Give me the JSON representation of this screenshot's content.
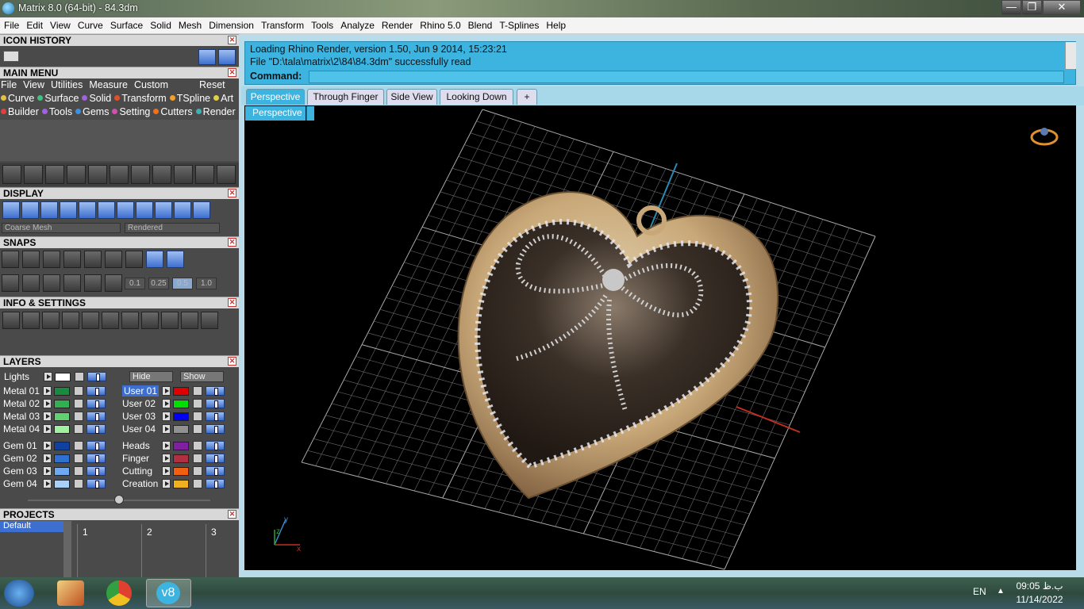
{
  "window": {
    "title": "Matrix 8.0 (64-bit) - 84.3dm",
    "min": "—",
    "max": "❐",
    "close": "✕"
  },
  "menubar": [
    "File",
    "Edit",
    "View",
    "Curve",
    "Surface",
    "Solid",
    "Mesh",
    "Dimension",
    "Transform",
    "Tools",
    "Analyze",
    "Render",
    "Rhino 5.0",
    "Blend",
    "T-Splines",
    "Help"
  ],
  "panels": {
    "icon_history": "ICON HISTORY",
    "main_menu": "MAIN MENU",
    "display": "DISPLAY",
    "snaps": "SNAPS",
    "info_settings": "INFO & SETTINGS",
    "layers": "LAYERS",
    "projects": "PROJECTS"
  },
  "main_menu": {
    "top": [
      "File",
      "View",
      "Utilities",
      "Measure",
      "Custom"
    ],
    "reset": "Reset",
    "row1": [
      {
        "label": "Curve",
        "color": "#e8c040"
      },
      {
        "label": "Surface",
        "color": "#40c080"
      },
      {
        "label": "Solid",
        "color": "#a060e0"
      },
      {
        "label": "Transform",
        "color": "#e05030"
      },
      {
        "label": "TSpline",
        "color": "#f0a030"
      },
      {
        "label": "Art",
        "color": "#e0d040"
      }
    ],
    "row2": [
      {
        "label": "Builder",
        "color": "#e04040"
      },
      {
        "label": "Tools",
        "color": "#a060e0"
      },
      {
        "label": "Gems",
        "color": "#4090e0"
      },
      {
        "label": "Setting",
        "color": "#d050b0"
      },
      {
        "label": "Cutters",
        "color": "#f07020"
      },
      {
        "label": "Render",
        "color": "#40b0b0"
      }
    ]
  },
  "display": {
    "mesh": "Coarse Mesh",
    "mode": "Rendered"
  },
  "snaps": {
    "values": [
      "0.1",
      "0.25",
      "0.5",
      "1.0"
    ]
  },
  "layers": {
    "lights": "Lights",
    "hide": "Hide",
    "show": "Show",
    "left_group1": [
      {
        "name": "Metal 01",
        "color": "#1a8a40"
      },
      {
        "name": "Metal 02",
        "color": "#30b050"
      },
      {
        "name": "Metal 03",
        "color": "#60d070"
      },
      {
        "name": "Metal 04",
        "color": "#a0f0a0"
      }
    ],
    "right_group1": [
      {
        "name": "User 01",
        "color": "#e00000"
      },
      {
        "name": "User 02",
        "color": "#00e000"
      },
      {
        "name": "User 03",
        "color": "#0000f0"
      },
      {
        "name": "User 04",
        "color": "#909090"
      }
    ],
    "left_group2": [
      {
        "name": "Gem 01",
        "color": "#1040a0"
      },
      {
        "name": "Gem 02",
        "color": "#3070d0"
      },
      {
        "name": "Gem 03",
        "color": "#70a8f0"
      },
      {
        "name": "Gem 04",
        "color": "#a8d0f8"
      }
    ],
    "right_group2": [
      {
        "name": "Heads",
        "color": "#8020a0"
      },
      {
        "name": "Finger",
        "color": "#b03040"
      },
      {
        "name": "Cutting",
        "color": "#f06010"
      },
      {
        "name": "Creation",
        "color": "#f0b020"
      }
    ]
  },
  "projects": {
    "default": "Default",
    "slots": [
      "1",
      "2",
      "3"
    ]
  },
  "command": {
    "line1": "Loading Rhino Render, version 1.50, Jun  9 2014, 15:23:21",
    "line2": "File \"D:\\tala\\matrix\\2\\84\\84.3dm\" successfully read",
    "prompt": "Command:"
  },
  "viewport_tabs": [
    "Perspective",
    "Through Finger",
    "Side View",
    "Looking Down"
  ],
  "add_tab": "+",
  "viewport_label": "Perspective",
  "axis": {
    "x": "x",
    "y": "y",
    "z": "z"
  },
  "taskbar": {
    "lang": "EN",
    "time": "09:05 ب.ظ",
    "date": "11/14/2022",
    "v8": "v8"
  }
}
